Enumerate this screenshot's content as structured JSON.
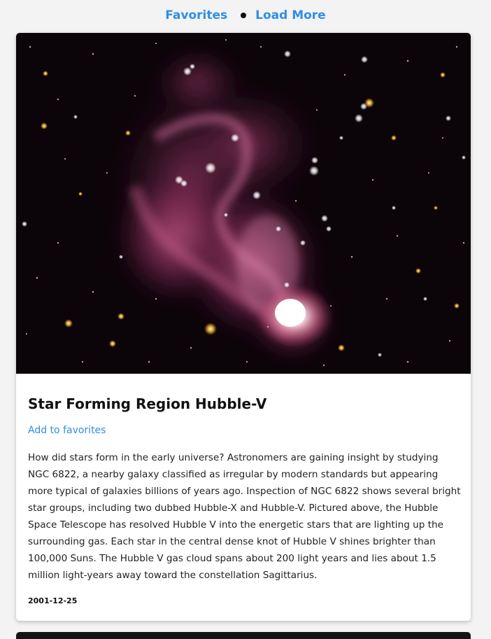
{
  "nav": {
    "favorites_label": "Favorites",
    "load_more_label": "Load More"
  },
  "card": {
    "image_alt": "Star Forming Region Hubble-V",
    "title": "Star Forming Region Hubble-V",
    "favorite_label": "Add to favorites",
    "explanation": "How did stars form in the early universe? Astronomers are gaining insight by studying NGC 6822, a nearby galaxy classified as irregular by modern standards but appearing more typical of galaxies billions of years ago. Inspection of NGC 6822 shows several bright star groups, including two dubbed Hubble-X and Hubble-V. Pictured above, the Hubble Space Telescope has resolved Hubble V into the energetic stars that are lighting up the surrounding gas. Each star in the central dense knot of Hubble V shines brighter than 100,000 Suns. The Hubble V gas cloud spans about 200 light years and lies about 1.5 million light-years away toward the constellation Sagittarius.",
    "date": "2001-12-25"
  },
  "colors": {
    "link": "#2f8ee5",
    "background": "#f3f3f3",
    "card": "#ffffff"
  }
}
